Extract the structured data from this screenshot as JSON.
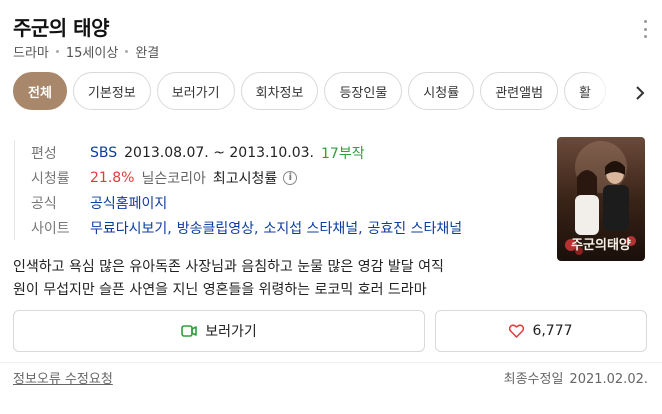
{
  "title": "주군의 태양",
  "meta": {
    "genre": "드라마",
    "rating": "15세이상",
    "status": "완결"
  },
  "tabs": [
    {
      "label": "전체",
      "active": true
    },
    {
      "label": "기본정보",
      "active": false
    },
    {
      "label": "보러가기",
      "active": false
    },
    {
      "label": "회차정보",
      "active": false
    },
    {
      "label": "등장인물",
      "active": false
    },
    {
      "label": "시청률",
      "active": false
    },
    {
      "label": "관련앨범",
      "active": false
    },
    {
      "label": "활",
      "active": false
    }
  ],
  "info": {
    "broadcast": {
      "label": "편성",
      "channel": "SBS",
      "period": "2013.08.07. ~ 2013.10.03.",
      "episodes": "17부작"
    },
    "viewership": {
      "label": "시청률",
      "value": "21.8%",
      "source": "닐슨코리아",
      "note": "최고시청률"
    },
    "official": {
      "label": "공식",
      "link": "공식홈페이지"
    },
    "sites": {
      "label": "사이트",
      "links": [
        "무료다시보기,",
        "방송클립영상,",
        "소지섭 스타채널,",
        "공효진 스타채널"
      ]
    }
  },
  "synopsis": {
    "line1": "인색하고 욕심 많은 유아독존 사장님과 음침하고 눈물 많은 영감 발달 여직",
    "line2": "원이 무섭지만 슬픈 사연을 지닌 영혼들을 위령하는 로코믹 호러 드라마"
  },
  "poster": {
    "caption": "주군의태양",
    "colors": {
      "bg": "#3a2418",
      "accent": "#b33232"
    }
  },
  "actions": {
    "watch_label": "보러가기",
    "like_count": "6,777"
  },
  "footer": {
    "report": "정보오류 수정요청",
    "modified_label": "최종수정일",
    "modified_date": "2021.02.02."
  },
  "colors": {
    "tab_active": "#a8876a",
    "link": "#0c3ea0",
    "episodes": "#2e9e3f",
    "rating_value": "#e23b3b",
    "like_heart": "#e23b3b",
    "watch_icon": "#2e9e3f"
  },
  "icons": {
    "more": "more-vertical-icon",
    "next": "chevron-right-icon",
    "info": "info-icon",
    "watch": "video-icon",
    "like": "heart-icon"
  }
}
